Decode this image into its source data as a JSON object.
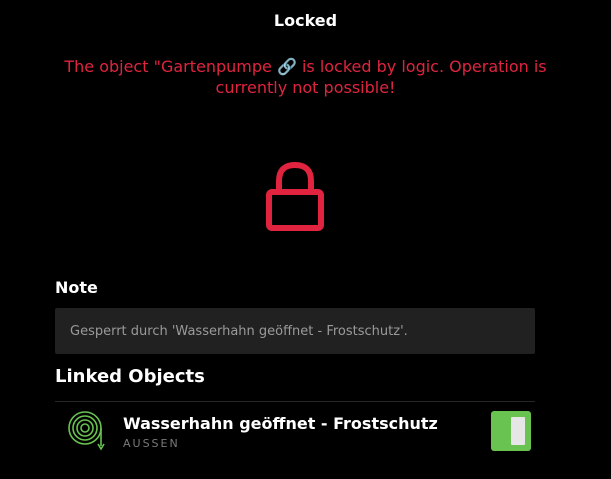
{
  "header": {
    "title": "Locked"
  },
  "message": {
    "text": "The object \"Gartenpumpe 🔗 is locked by logic. Operation is currently not possible!"
  },
  "icons": {
    "lock": "lock-icon",
    "hose": "hose-icon",
    "switch": "toggle-switch"
  },
  "note": {
    "label": "Note",
    "text": "Gesperrt durch 'Wasserhahn geöffnet - Frostschutz'."
  },
  "linked": {
    "label": "Linked Objects",
    "items": [
      {
        "name": "Wasserhahn geöffnet - Frostschutz",
        "room": "AUSSEN",
        "state": "on"
      }
    ]
  },
  "colors": {
    "background": "#000000",
    "alert_red": "#e0243f",
    "accent_green": "#69c350",
    "note_background": "#212121"
  }
}
